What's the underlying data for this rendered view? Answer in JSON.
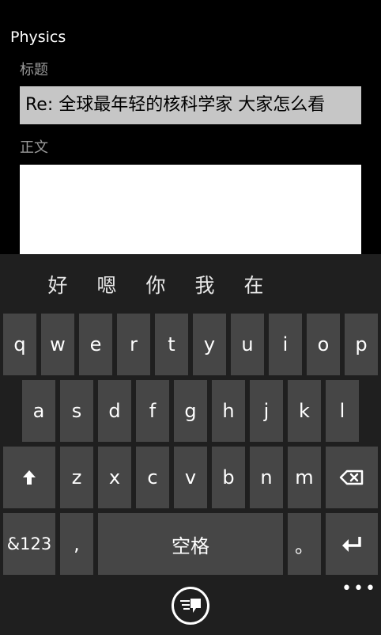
{
  "app": {
    "title": "Physics"
  },
  "form": {
    "title_label": "标题",
    "title_value": "Re: 全球最年轻的核科学家 大家怎么看",
    "body_label": "正文",
    "body_value": ""
  },
  "keyboard": {
    "suggestions": [
      "好",
      "嗯",
      "你",
      "我",
      "在"
    ],
    "row1": [
      "q",
      "w",
      "e",
      "r",
      "t",
      "y",
      "u",
      "i",
      "o",
      "p"
    ],
    "row2": [
      "a",
      "s",
      "d",
      "f",
      "g",
      "h",
      "j",
      "k",
      "l"
    ],
    "row3": [
      "z",
      "x",
      "c",
      "v",
      "b",
      "n",
      "m"
    ],
    "symbols_label": "&123",
    "comma_label": ",",
    "space_label": "空格",
    "period_label": "。",
    "shift_icon": "shift-arrow-icon",
    "backspace_icon": "backspace-icon",
    "enter_icon": "enter-icon",
    "emoji_icon": "emoji-icon",
    "more_label": "•••"
  },
  "colors": {
    "background": "#000000",
    "keyboard_bg": "#1f1f1f",
    "key_bg": "#464646",
    "text_field_bg": "#c6c6c6"
  }
}
